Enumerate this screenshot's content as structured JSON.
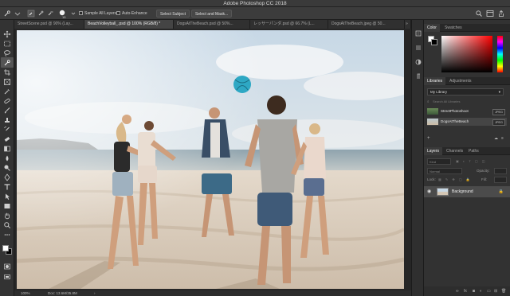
{
  "window": {
    "title": "Adobe Photoshop CC 2018"
  },
  "options_bar": {
    "brush_size": "15",
    "sample_all_layers_label": "Sample All Layers",
    "auto_enhance_label": "Auto-Enhance",
    "select_subject_label": "Select Subject",
    "select_and_mask_label": "Select and Mask..."
  },
  "tabs": [
    {
      "label": "StreetScene.psd @ 90% (Lay..."
    },
    {
      "label": "BeachVolleyball_.psd @ 100% (RGB/8) *"
    },
    {
      "label": "DogsAtTheBeach.psd @ 50%..."
    },
    {
      "label": "レッサーパンダ.psd @ 66.7% (L..."
    },
    {
      "label": "DogsAtTheBeach.jpeg @ 50..."
    }
  ],
  "status_bar": {
    "zoom": "100%",
    "doc": "Doc: 13.6M/35.8M"
  },
  "panels": {
    "color": {
      "tabs": [
        "Color",
        "Swatches"
      ]
    },
    "libraries": {
      "tabs": [
        "Libraries",
        "Adjustments"
      ],
      "library_select": "My Library",
      "search_placeholder": "Search All Libraries",
      "items": [
        {
          "label": "StreetPhotoshoot",
          "tag": "JPEG"
        },
        {
          "label": "DogsAtTheBeach",
          "tag": "JPEG"
        }
      ]
    },
    "layers": {
      "tabs": [
        "Layers",
        "Channels",
        "Paths"
      ],
      "kind_label": "Kind",
      "blend_mode": "Normal",
      "opacity_label": "Opacity:",
      "lock_label": "Lock:",
      "fill_label": "Fill:",
      "items": [
        {
          "name": "Background"
        }
      ]
    }
  },
  "colors": {
    "accent": "#3b7fd4",
    "foreground_swatch": "#ffffff",
    "background_swatch": "#000000"
  }
}
